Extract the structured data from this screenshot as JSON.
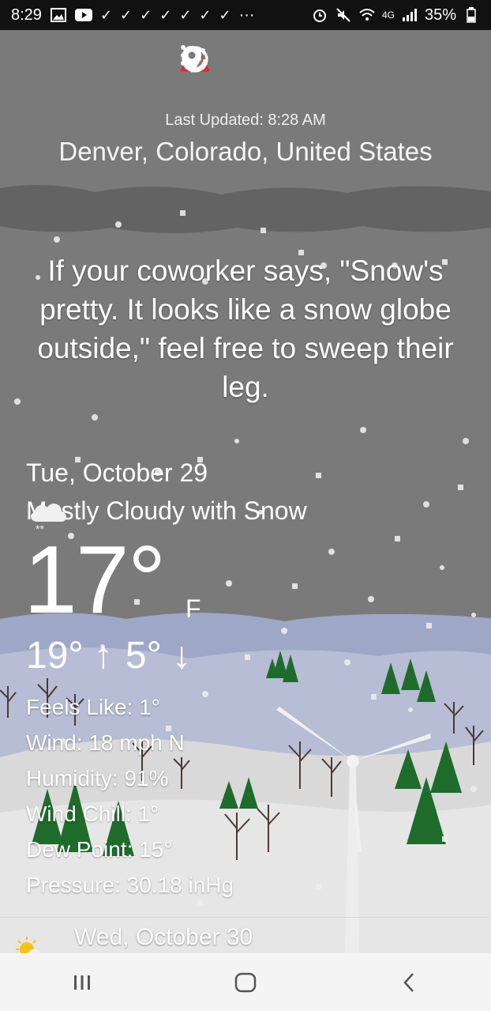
{
  "status_bar": {
    "time": "8:29",
    "network": "4G",
    "battery": "35%"
  },
  "toolbar": {
    "icons": [
      "alert-icon",
      "refresh-icon",
      "history-icon",
      "add-location-icon",
      "location-pin-icon",
      "more-icon"
    ],
    "alert_color": "#e32b2b"
  },
  "header": {
    "last_updated": "Last Updated: 8:28 AM",
    "location": "Denver, Colorado, United States"
  },
  "quote": "If your coworker says, \"Snow's pretty. It looks like a snow globe outside,\" feel free to sweep their leg.",
  "current": {
    "date": "Tue, October 29",
    "condition": "Mostly Cloudy with Snow",
    "condition_icon": "cloud-snow-icon",
    "temperature": "17°",
    "unit": "F",
    "high": "19° ↑",
    "low": "5° ↓",
    "details": [
      "Feels Like: 1°",
      "Wind: 18 mph N",
      "Humidity: 91%",
      "Wind Chill: 1°",
      "Dew Point: 15°",
      "Pressure: 30.18 inHg"
    ]
  },
  "forecast": {
    "next_date": "Wed, October 30",
    "next_icon": "partly-sunny-icon"
  },
  "colors": {
    "sky": "#7a7a7a",
    "hills": "#9ea8c6",
    "snow": "#e8e8e8",
    "tree": "#1f6b2c"
  }
}
